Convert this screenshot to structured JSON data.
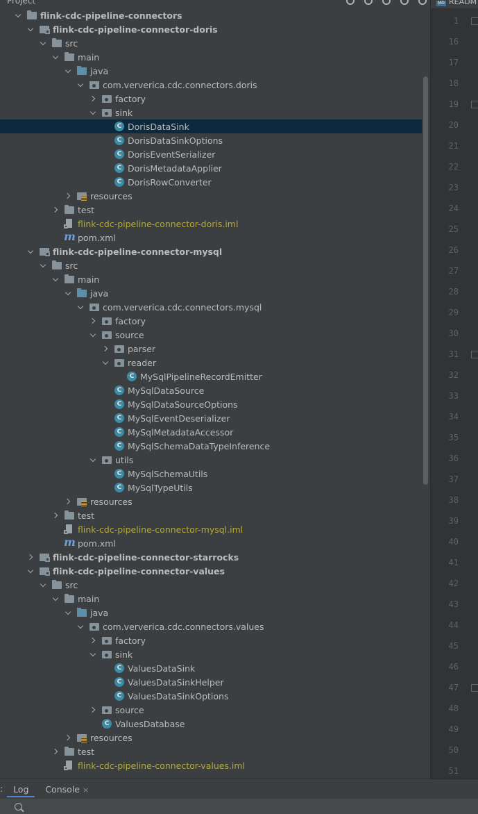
{
  "window": {
    "panel_title": "Project",
    "editor_tab": "READM"
  },
  "tree": [
    {
      "label": "flink-cdc-pipeline-connectors",
      "depth": 1,
      "icon": "folder",
      "arrow": "open",
      "bold": true
    },
    {
      "label": "flink-cdc-pipeline-connector-doris",
      "depth": 2,
      "icon": "module",
      "arrow": "open",
      "bold": true
    },
    {
      "label": "src",
      "depth": 3,
      "icon": "folder",
      "arrow": "open"
    },
    {
      "label": "main",
      "depth": 4,
      "icon": "folder",
      "arrow": "open"
    },
    {
      "label": "java",
      "depth": 5,
      "icon": "src-folder",
      "arrow": "open"
    },
    {
      "label": "com.ververica.cdc.connectors.doris",
      "depth": 6,
      "icon": "package",
      "arrow": "open"
    },
    {
      "label": "factory",
      "depth": 7,
      "icon": "package",
      "arrow": "closed"
    },
    {
      "label": "sink",
      "depth": 7,
      "icon": "package",
      "arrow": "open"
    },
    {
      "label": "DorisDataSink",
      "depth": 8,
      "icon": "class",
      "arrow": "none",
      "selected": true
    },
    {
      "label": "DorisDataSinkOptions",
      "depth": 8,
      "icon": "class",
      "arrow": "none"
    },
    {
      "label": "DorisEventSerializer",
      "depth": 8,
      "icon": "class",
      "arrow": "none"
    },
    {
      "label": "DorisMetadataApplier",
      "depth": 8,
      "icon": "class",
      "arrow": "none"
    },
    {
      "label": "DorisRowConverter",
      "depth": 8,
      "icon": "class",
      "arrow": "none"
    },
    {
      "label": "resources",
      "depth": 5,
      "icon": "res-folder",
      "arrow": "closed"
    },
    {
      "label": "test",
      "depth": 4,
      "icon": "folder",
      "arrow": "closed"
    },
    {
      "label": "flink-cdc-pipeline-connector-doris.iml",
      "depth": 4,
      "icon": "iml",
      "arrow": "none",
      "iml": true
    },
    {
      "label": "pom.xml",
      "depth": 4,
      "icon": "maven",
      "arrow": "none"
    },
    {
      "label": "flink-cdc-pipeline-connector-mysql",
      "depth": 2,
      "icon": "module",
      "arrow": "open",
      "bold": true
    },
    {
      "label": "src",
      "depth": 3,
      "icon": "folder",
      "arrow": "open"
    },
    {
      "label": "main",
      "depth": 4,
      "icon": "folder",
      "arrow": "open"
    },
    {
      "label": "java",
      "depth": 5,
      "icon": "src-folder",
      "arrow": "open"
    },
    {
      "label": "com.ververica.cdc.connectors.mysql",
      "depth": 6,
      "icon": "package",
      "arrow": "open"
    },
    {
      "label": "factory",
      "depth": 7,
      "icon": "package",
      "arrow": "closed"
    },
    {
      "label": "source",
      "depth": 7,
      "icon": "package",
      "arrow": "open"
    },
    {
      "label": "parser",
      "depth": 8,
      "icon": "package",
      "arrow": "closed"
    },
    {
      "label": "reader",
      "depth": 8,
      "icon": "package",
      "arrow": "open"
    },
    {
      "label": "MySqlPipelineRecordEmitter",
      "depth": 9,
      "icon": "class",
      "arrow": "none"
    },
    {
      "label": "MySqlDataSource",
      "depth": 8,
      "icon": "class",
      "arrow": "none"
    },
    {
      "label": "MySqlDataSourceOptions",
      "depth": 8,
      "icon": "class",
      "arrow": "none"
    },
    {
      "label": "MySqlEventDeserializer",
      "depth": 8,
      "icon": "class",
      "arrow": "none"
    },
    {
      "label": "MySqlMetadataAccessor",
      "depth": 8,
      "icon": "class",
      "arrow": "none"
    },
    {
      "label": "MySqlSchemaDataTypeInference",
      "depth": 8,
      "icon": "class",
      "arrow": "none"
    },
    {
      "label": "utils",
      "depth": 7,
      "icon": "package",
      "arrow": "open"
    },
    {
      "label": "MySqlSchemaUtils",
      "depth": 8,
      "icon": "class",
      "arrow": "none"
    },
    {
      "label": "MySqlTypeUtils",
      "depth": 8,
      "icon": "class",
      "arrow": "none"
    },
    {
      "label": "resources",
      "depth": 5,
      "icon": "res-folder",
      "arrow": "closed"
    },
    {
      "label": "test",
      "depth": 4,
      "icon": "folder",
      "arrow": "closed"
    },
    {
      "label": "flink-cdc-pipeline-connector-mysql.iml",
      "depth": 4,
      "icon": "iml",
      "arrow": "none",
      "iml": true
    },
    {
      "label": "pom.xml",
      "depth": 4,
      "icon": "maven",
      "arrow": "none"
    },
    {
      "label": "flink-cdc-pipeline-connector-starrocks",
      "depth": 2,
      "icon": "module",
      "arrow": "closed",
      "bold": true
    },
    {
      "label": "flink-cdc-pipeline-connector-values",
      "depth": 2,
      "icon": "module",
      "arrow": "open",
      "bold": true
    },
    {
      "label": "src",
      "depth": 3,
      "icon": "folder",
      "arrow": "open"
    },
    {
      "label": "main",
      "depth": 4,
      "icon": "folder",
      "arrow": "open"
    },
    {
      "label": "java",
      "depth": 5,
      "icon": "src-folder",
      "arrow": "open"
    },
    {
      "label": "com.ververica.cdc.connectors.values",
      "depth": 6,
      "icon": "package",
      "arrow": "open"
    },
    {
      "label": "factory",
      "depth": 7,
      "icon": "package",
      "arrow": "closed"
    },
    {
      "label": "sink",
      "depth": 7,
      "icon": "package",
      "arrow": "open"
    },
    {
      "label": "ValuesDataSink",
      "depth": 8,
      "icon": "class",
      "arrow": "none"
    },
    {
      "label": "ValuesDataSinkHelper",
      "depth": 8,
      "icon": "class",
      "arrow": "none"
    },
    {
      "label": "ValuesDataSinkOptions",
      "depth": 8,
      "icon": "class",
      "arrow": "none"
    },
    {
      "label": "source",
      "depth": 7,
      "icon": "package",
      "arrow": "closed"
    },
    {
      "label": "ValuesDatabase",
      "depth": 7,
      "icon": "class",
      "arrow": "none"
    },
    {
      "label": "resources",
      "depth": 5,
      "icon": "res-folder",
      "arrow": "closed"
    },
    {
      "label": "test",
      "depth": 4,
      "icon": "folder",
      "arrow": "closed"
    },
    {
      "label": "flink-cdc-pipeline-connector-values.iml",
      "depth": 4,
      "icon": "iml",
      "arrow": "none",
      "iml": true
    }
  ],
  "gutter": {
    "line_numbers": [
      "1",
      "16",
      "17",
      "18",
      "19",
      "20",
      "21",
      "22",
      "23",
      "24",
      "25",
      "26",
      "27",
      "28",
      "29",
      "30",
      "31",
      "32",
      "33",
      "34",
      "35",
      "36",
      "37",
      "38",
      "39",
      "40",
      "41",
      "42",
      "43",
      "44",
      "45",
      "46",
      "47",
      "48",
      "49",
      "50",
      "51"
    ],
    "fold_markers": [
      "1",
      "19",
      "31",
      "47"
    ]
  },
  "bottom": {
    "prefix": ":",
    "tabs": [
      {
        "label": "Log",
        "active": true
      },
      {
        "label": "Console",
        "active": false
      }
    ],
    "close_symbol": "×"
  },
  "colors": {
    "background": "#3c3f41",
    "selection": "#0d293e",
    "iml_text": "#b2aa3c",
    "class_icon": "#3d8aa5"
  }
}
